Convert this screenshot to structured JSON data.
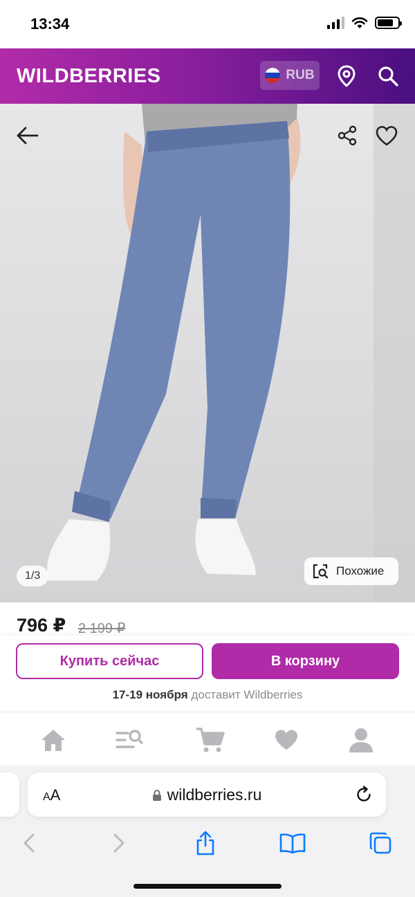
{
  "status_bar": {
    "time": "13:34"
  },
  "header": {
    "brand": "WILDBERRIES",
    "currency": "RUB",
    "colors": {
      "gradient_start": "#b12ba8",
      "gradient_end": "#4a0f80"
    },
    "icons": [
      "location-pin-icon",
      "search-icon"
    ]
  },
  "product": {
    "image": "light-blue mom jeans with white sneakers",
    "counter": "1/3",
    "similar_label": "Похожие",
    "icons": [
      "back-arrow-icon",
      "share-icon",
      "heart-icon",
      "image-search-icon"
    ]
  },
  "pricing": {
    "price": "796 ₽",
    "old_price": "2 199 ₽"
  },
  "actions": {
    "buy_now": "Купить сейчас",
    "add_to_cart": "В корзину",
    "delivery_date": "17-19 ноября",
    "delivery_text": " доставит Wildberries",
    "accent": "#b12ba8"
  },
  "tabbar": {
    "icons": [
      "home-icon",
      "catalog-search-icon",
      "cart-icon",
      "favorites-icon",
      "profile-icon"
    ]
  },
  "browser": {
    "aa_label_small": "A",
    "aa_label_big": "A",
    "url": "wildberries.ru",
    "icons": [
      "lock-icon",
      "reload-icon",
      "back-icon",
      "forward-icon",
      "share-icon",
      "bookmarks-icon",
      "tabs-icon"
    ]
  }
}
